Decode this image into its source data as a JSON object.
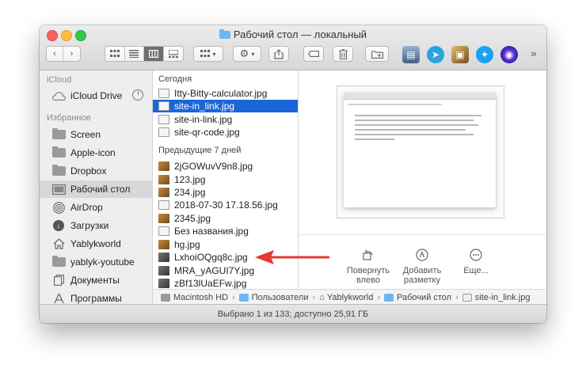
{
  "window": {
    "title": "Рабочий стол — локальный"
  },
  "toolbar": {
    "back_icon": "chevron-left-icon",
    "forward_icon": "chevron-right-icon",
    "views": [
      "icon-view",
      "list-view",
      "column-view",
      "gallery-view"
    ],
    "active_view": "column-view",
    "more_label": "»"
  },
  "sidebar": {
    "icloud_header": "iCloud",
    "icloud_drive": "iCloud Drive",
    "favorites_header": "Избранное",
    "items": [
      {
        "label": "Screen",
        "icon": "folder-icon"
      },
      {
        "label": "Apple-icon",
        "icon": "folder-icon"
      },
      {
        "label": "Dropbox",
        "icon": "folder-icon"
      },
      {
        "label": "Рабочий стол",
        "icon": "desktop-icon"
      },
      {
        "label": "AirDrop",
        "icon": "airdrop-icon"
      },
      {
        "label": "Загрузки",
        "icon": "downloads-icon"
      },
      {
        "label": "Yablykworld",
        "icon": "home-icon"
      },
      {
        "label": "yablyk-youtube",
        "icon": "folder-icon"
      },
      {
        "label": "Документы",
        "icon": "documents-icon"
      },
      {
        "label": "Программы",
        "icon": "applications-icon"
      }
    ],
    "selected_item": "Рабочий стол"
  },
  "column": {
    "today_header": "Сегодня",
    "today_files": [
      {
        "name": "Itty-Bitty-calculator.jpg",
        "thumb": "doc"
      },
      {
        "name": "site-in_link.jpg",
        "thumb": "doc",
        "selected": true
      },
      {
        "name": "site-in-link.jpg",
        "thumb": "doc"
      },
      {
        "name": "site-qr-code.jpg",
        "thumb": "doc"
      }
    ],
    "prev_header": "Предыдущие 7 дней",
    "prev_files": [
      {
        "name": "2jGOWuvV9n8.jpg",
        "thumb": "photo"
      },
      {
        "name": "123.jpg",
        "thumb": "photo"
      },
      {
        "name": "234.jpg",
        "thumb": "photo"
      },
      {
        "name": "2018-07-30 17.18.56.jpg",
        "thumb": "doc"
      },
      {
        "name": "2345.jpg",
        "thumb": "photo"
      },
      {
        "name": "Без названия.jpg",
        "thumb": "doc"
      },
      {
        "name": "hg.jpg",
        "thumb": "photo"
      },
      {
        "name": "LxhoiOQgq8c.jpg",
        "thumb": "dark"
      },
      {
        "name": "MRA_yAGUI7Y.jpg",
        "thumb": "dark"
      },
      {
        "name": "zBf13lUaEFw.jpg",
        "thumb": "dark"
      }
    ]
  },
  "preview": {
    "actions": [
      {
        "label": "Повернуть влево",
        "icon": "rotate-left-icon"
      },
      {
        "label": "Добавить разметку",
        "icon": "markup-icon"
      },
      {
        "label": "Еще...",
        "icon": "more-icon"
      }
    ]
  },
  "pathbar": {
    "segments": [
      "Macintosh HD",
      "Пользователи",
      "Yablykworld",
      "Рабочий стол",
      "site-in_link.jpg"
    ],
    "separator": "›"
  },
  "status": {
    "text": "Выбрано 1 из 133; доступно 25,91 ГБ"
  },
  "colors": {
    "selection": "#1a66d9",
    "arrow": "#e23a2e",
    "folder_blue": "#6cb6f4"
  }
}
